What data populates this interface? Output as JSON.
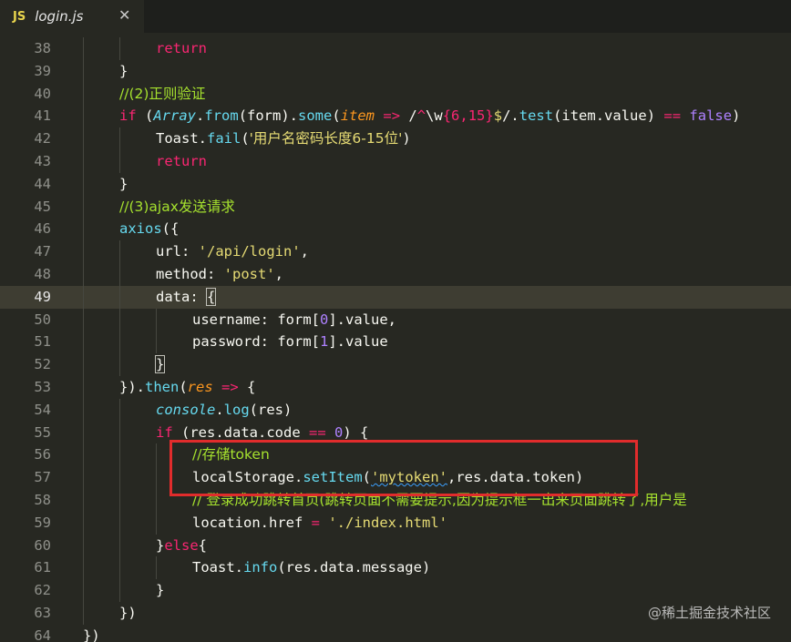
{
  "tab": {
    "lang_badge": "JS",
    "filename": "login.js",
    "close_glyph": "✕"
  },
  "editor": {
    "active_line": 49,
    "lines": [
      {
        "n": "38",
        "ind": 2,
        "tokens": [
          [
            "k",
            "return"
          ]
        ]
      },
      {
        "n": "39",
        "ind": 1,
        "tokens": [
          [
            "w",
            "}"
          ]
        ]
      },
      {
        "n": "40",
        "ind": 1,
        "tokens": [
          [
            "c",
            "//(2)正则验证"
          ]
        ]
      },
      {
        "n": "41",
        "ind": 1,
        "tokens": [
          [
            "k",
            "if"
          ],
          [
            "w",
            " ("
          ],
          [
            "t",
            "Array"
          ],
          [
            "w",
            "."
          ],
          [
            "f",
            "from"
          ],
          [
            "w",
            "(form)."
          ],
          [
            "f",
            "some"
          ],
          [
            "w",
            "("
          ],
          [
            "p",
            "item"
          ],
          [
            "w",
            " "
          ],
          [
            "k",
            "=>"
          ],
          [
            "w",
            " /"
          ],
          [
            "k",
            "^"
          ],
          [
            "w",
            "\\w"
          ],
          [
            "k",
            "{6,15}"
          ],
          [
            "s",
            "$"
          ],
          [
            "w",
            "/."
          ],
          [
            "f",
            "test"
          ],
          [
            "w",
            "(item.value) "
          ],
          [
            "k",
            "=="
          ],
          [
            "w",
            " "
          ],
          [
            "n",
            "false"
          ],
          [
            "w",
            ")"
          ]
        ]
      },
      {
        "n": "42",
        "ind": 2,
        "tokens": [
          [
            "w",
            "Toast."
          ],
          [
            "f",
            "fail"
          ],
          [
            "w",
            "("
          ],
          [
            "s",
            "'用户名密码长度6-15位'"
          ],
          [
            "w",
            ")"
          ]
        ]
      },
      {
        "n": "43",
        "ind": 2,
        "tokens": [
          [
            "k",
            "return"
          ]
        ]
      },
      {
        "n": "44",
        "ind": 1,
        "tokens": [
          [
            "w",
            "}"
          ]
        ]
      },
      {
        "n": "45",
        "ind": 1,
        "tokens": [
          [
            "c",
            "//(3)ajax发送请求"
          ]
        ]
      },
      {
        "n": "46",
        "ind": 1,
        "tokens": [
          [
            "f",
            "axios"
          ],
          [
            "w",
            "({"
          ]
        ]
      },
      {
        "n": "47",
        "ind": 2,
        "tokens": [
          [
            "w",
            "url: "
          ],
          [
            "s",
            "'/api/login'"
          ],
          [
            "w",
            ","
          ]
        ]
      },
      {
        "n": "48",
        "ind": 2,
        "tokens": [
          [
            "w",
            "method: "
          ],
          [
            "s",
            "'post'"
          ],
          [
            "w",
            ","
          ]
        ]
      },
      {
        "n": "49",
        "ind": 2,
        "tokens": [
          [
            "w",
            "data: "
          ],
          [
            "w",
            "{"
          ]
        ]
      },
      {
        "n": "50",
        "ind": 3,
        "tokens": [
          [
            "w",
            "username: form["
          ],
          [
            "n",
            "0"
          ],
          [
            "w",
            "].value,"
          ]
        ]
      },
      {
        "n": "51",
        "ind": 3,
        "tokens": [
          [
            "w",
            "password: form["
          ],
          [
            "n",
            "1"
          ],
          [
            "w",
            "].value"
          ]
        ]
      },
      {
        "n": "52",
        "ind": 2,
        "tokens": [
          [
            "w",
            "}"
          ]
        ]
      },
      {
        "n": "53",
        "ind": 1,
        "tokens": [
          [
            "w",
            "})."
          ],
          [
            "f",
            "then"
          ],
          [
            "w",
            "("
          ],
          [
            "p",
            "res"
          ],
          [
            "w",
            " "
          ],
          [
            "k",
            "=>"
          ],
          [
            "w",
            " {"
          ]
        ]
      },
      {
        "n": "54",
        "ind": 2,
        "tokens": [
          [
            "t",
            "console"
          ],
          [
            "w",
            "."
          ],
          [
            "f",
            "log"
          ],
          [
            "w",
            "(res)"
          ]
        ]
      },
      {
        "n": "55",
        "ind": 2,
        "tokens": [
          [
            "k",
            "if"
          ],
          [
            "w",
            " (res.data.code "
          ],
          [
            "k",
            "=="
          ],
          [
            "w",
            " "
          ],
          [
            "n",
            "0"
          ],
          [
            "w",
            ") {"
          ]
        ]
      },
      {
        "n": "56",
        "ind": 3,
        "tokens": [
          [
            "c",
            "//存储token"
          ]
        ]
      },
      {
        "n": "57",
        "ind": 3,
        "tokens": [
          [
            "w",
            "localStorage."
          ],
          [
            "f",
            "setItem"
          ],
          [
            "w",
            "("
          ],
          [
            "s",
            "'mytoken'"
          ],
          [
            "w",
            ",res.data.token)"
          ]
        ]
      },
      {
        "n": "58",
        "ind": 3,
        "tokens": [
          [
            "c",
            "// 登录成功跳转首页(跳转页面不需要提示,因为提示框一出来页面跳转了,用户是"
          ]
        ]
      },
      {
        "n": "59",
        "ind": 3,
        "tokens": [
          [
            "w",
            "location.href "
          ],
          [
            "k",
            "="
          ],
          [
            "w",
            " "
          ],
          [
            "s",
            "'./index.html'"
          ]
        ]
      },
      {
        "n": "60",
        "ind": 2,
        "tokens": [
          [
            "w",
            "}"
          ],
          [
            "k",
            "else"
          ],
          [
            "w",
            "{"
          ]
        ]
      },
      {
        "n": "61",
        "ind": 3,
        "tokens": [
          [
            "w",
            "Toast."
          ],
          [
            "f",
            "info"
          ],
          [
            "w",
            "(res.data.message)"
          ]
        ]
      },
      {
        "n": "62",
        "ind": 2,
        "tokens": [
          [
            "w",
            "}"
          ]
        ]
      },
      {
        "n": "63",
        "ind": 1,
        "tokens": [
          [
            "w",
            "})"
          ]
        ]
      },
      {
        "n": "64",
        "ind": 0,
        "tokens": [
          [
            "w",
            "})"
          ]
        ]
      }
    ]
  },
  "colors": {
    "background": "#272822",
    "keyword": "#f92672",
    "function": "#66d9ef",
    "comment": "#a6e22e",
    "string": "#e6db74",
    "number": "#ae81ff",
    "highlight_box": "#e12c2c"
  },
  "watermark": "@稀土掘金技术社区"
}
